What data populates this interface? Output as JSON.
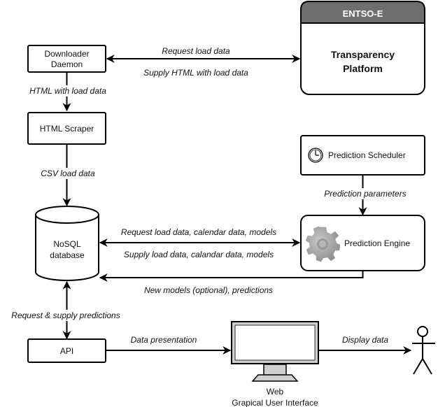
{
  "nodes": {
    "downloader": {
      "line1": "Downloader",
      "line2": "Daemon"
    },
    "entsoe": {
      "header": "ENTSO-E",
      "line1": "Transparency",
      "line2": "Platform",
      "header_color": "#6e6e6e"
    },
    "scraper": {
      "label": "HTML Scraper"
    },
    "scheduler": {
      "label": "Prediction Scheduler",
      "icon": "clock-icon"
    },
    "database": {
      "line1": "NoSQL",
      "line2": "database"
    },
    "engine": {
      "label": "Prediction Engine",
      "icon": "gear-icon"
    },
    "api": {
      "label": "API"
    },
    "gui": {
      "line1": "Web",
      "line2": "Grapical User Interface",
      "icon": "monitor-icon"
    },
    "user": {
      "icon": "stick-figure-icon"
    }
  },
  "edges": {
    "request_load": "Request load data",
    "supply_html": "Supply HTML with load data",
    "html_with_load": "HTML with load data",
    "csv_load": "CSV load data",
    "prediction_params": "Prediction parameters",
    "request_calendar": "Request load data, calendar data, models",
    "supply_calendar": "Supply load data, calandar data, models",
    "new_models": "New models (optional), predictions",
    "request_supply_predictions": "Request & supply predictions",
    "data_presentation": "Data presentation",
    "display_data": "Display data"
  }
}
